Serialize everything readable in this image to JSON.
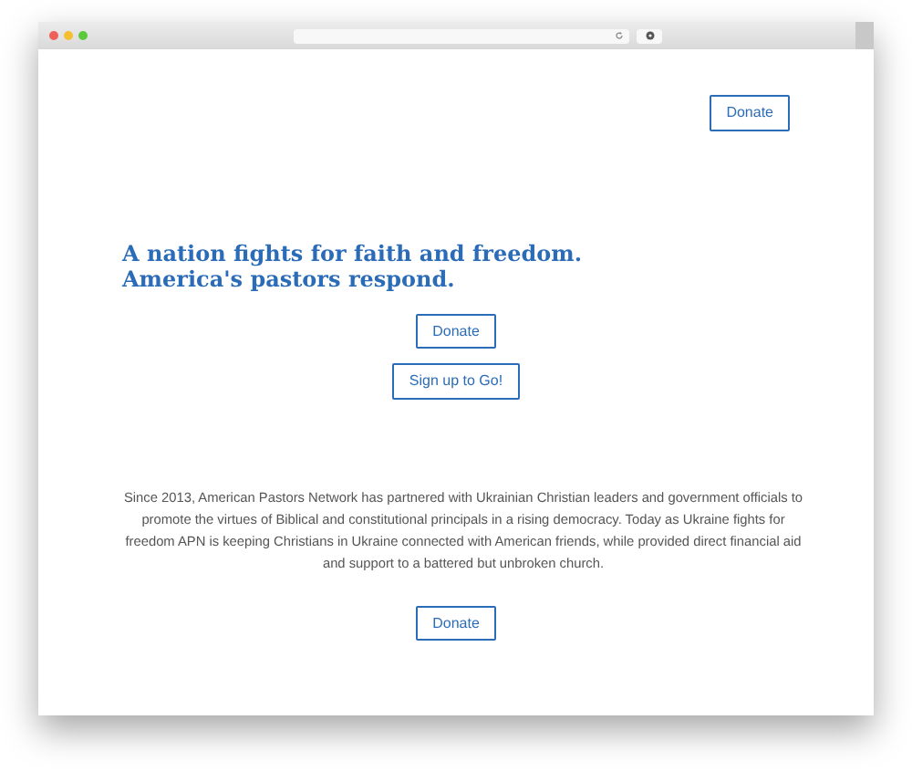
{
  "header": {
    "button": "Donate"
  },
  "hero": {
    "heading_lines": [
      "A nation fights for faith and freedom.",
      "America's pastors respond."
    ],
    "buttons": [
      "Donate",
      "Sign up to Go!"
    ]
  },
  "about": {
    "text": "Since 2013, American Pastors Network has partnered with Ukrainian Christian leaders and government officials to promote the virtues of Biblical and constitutional principals in a rising democracy. Today as Ukraine fights for freedom APN is keeping Christians in Ukraine connected with American friends, while provided direct financial aid and support to a battered but unbroken church.",
    "button": "Donate"
  }
}
